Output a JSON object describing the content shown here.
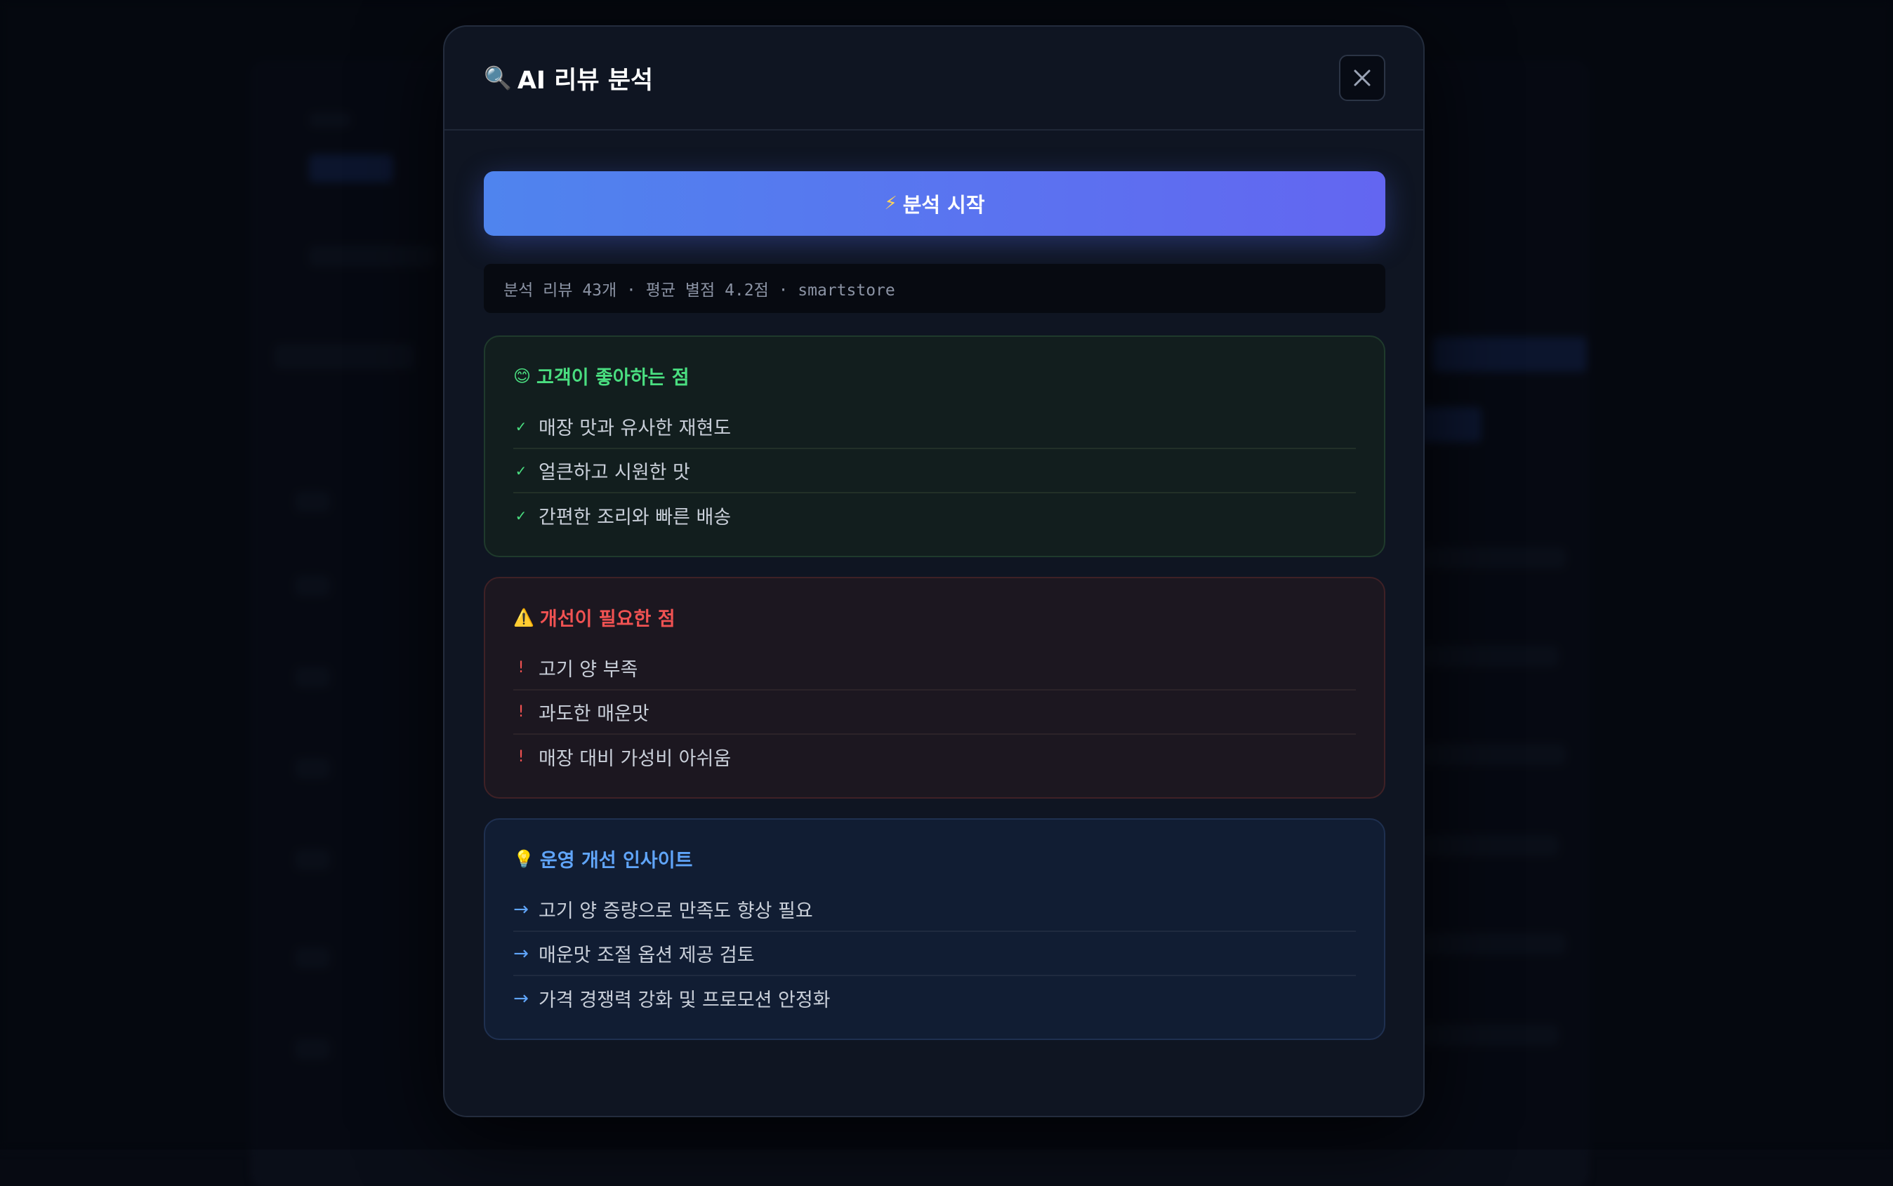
{
  "modal": {
    "title_icon": "magnifier-icon",
    "title_icon_glyph": "🔍",
    "title": "AI 리뷰 분석",
    "close_icon": "close-icon"
  },
  "analyze_button": {
    "icon": "lightning-icon",
    "icon_glyph": "⚡",
    "label": "분석 시작",
    "gradient": [
      "#4f84ee",
      "#6366f1"
    ]
  },
  "meta": {
    "text": "분석 리뷰 43개 · 평균 별점 4.2점 · smartstore"
  },
  "positive": {
    "icon": "smile-icon",
    "icon_glyph": "😊",
    "title": "고객이 좋아하는 점",
    "bullet": "✓",
    "color": "#4ade80",
    "items": [
      "매장 맛과 유사한 재현도",
      "얼큰하고 시원한 맛",
      "간편한 조리와 빠른 배송"
    ]
  },
  "negative": {
    "icon": "warning-icon",
    "icon_glyph": "⚠️",
    "title": "개선이 필요한 점",
    "bullet": "!",
    "color": "#f05252",
    "items": [
      "고기 양 부족",
      "과도한 매운맛",
      "매장 대비 가성비 아쉬움"
    ]
  },
  "insights": {
    "icon": "lightbulb-icon",
    "icon_glyph": "💡",
    "title": "운영 개선 인사이트",
    "bullet": "→",
    "color": "#60a5fa",
    "items": [
      "고기 양 증량으로 만족도 향상 필요",
      "매운맛 조절 옵션 제공 검토",
      "가격 경쟁력 강화 및 프로모션 안정화"
    ]
  }
}
